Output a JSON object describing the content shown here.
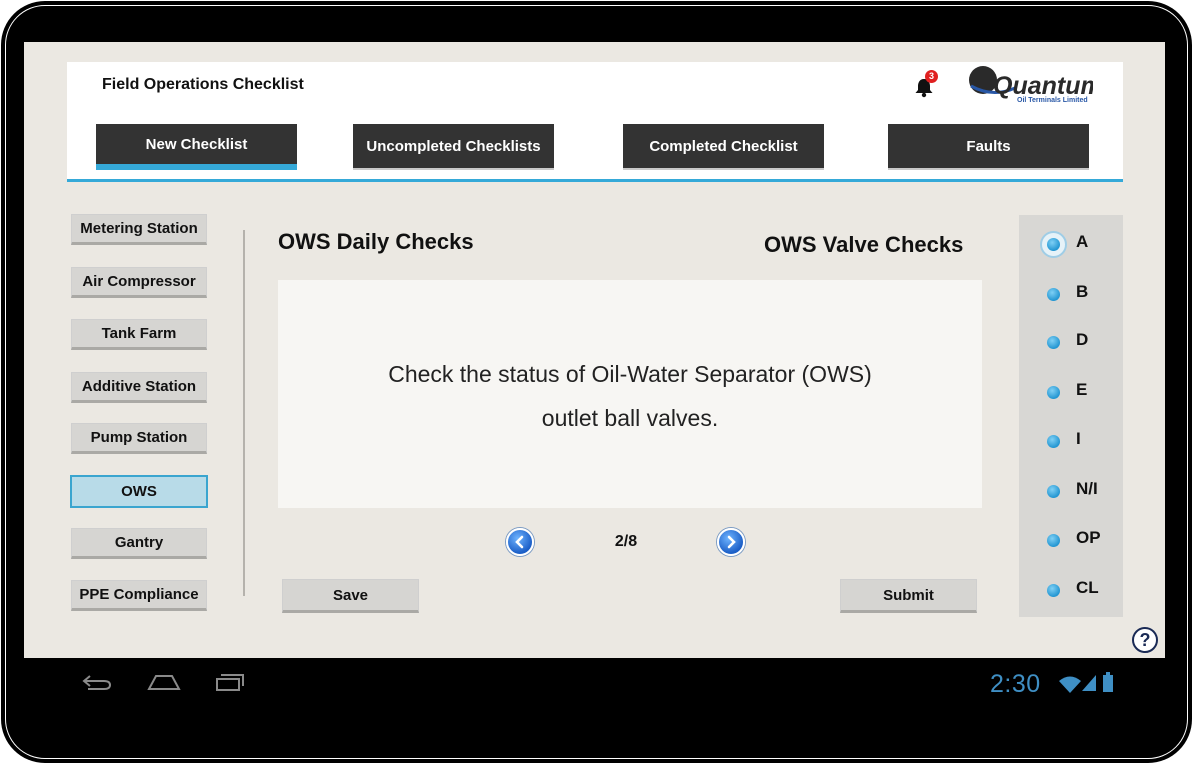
{
  "header": {
    "app_title": "Field Operations Checklist",
    "notification_count": "3",
    "logo_text": "Quantum",
    "logo_subtitle": "Oil Terminals Limited"
  },
  "nav": {
    "tabs": [
      {
        "label": "New Checklist",
        "active": true
      },
      {
        "label": "Uncompleted Checklists",
        "active": false
      },
      {
        "label": "Completed Checklist",
        "active": false
      },
      {
        "label": "Faults",
        "active": false
      }
    ]
  },
  "sidebar": {
    "items": [
      {
        "label": "Metering Station"
      },
      {
        "label": "Air Compressor"
      },
      {
        "label": "Tank Farm"
      },
      {
        "label": "Additive Station"
      },
      {
        "label": "Pump Station"
      },
      {
        "label": "OWS",
        "active": true
      },
      {
        "label": "Gantry"
      },
      {
        "label": "PPE Compliance"
      }
    ]
  },
  "main": {
    "section_title": "OWS Daily Checks",
    "subsection_title": "OWS Valve Checks",
    "question_line1": "Check the status of Oil-Water Separator (OWS)",
    "question_line2": "outlet ball valves.",
    "pager": {
      "current": 2,
      "total": 8,
      "label": "2/8"
    },
    "save_label": "Save",
    "submit_label": "Submit"
  },
  "options": {
    "items": [
      {
        "label": "A",
        "selected": true
      },
      {
        "label": "B",
        "selected": false
      },
      {
        "label": "D",
        "selected": false
      },
      {
        "label": "E",
        "selected": false
      },
      {
        "label": "I",
        "selected": false
      },
      {
        "label": "N/I",
        "selected": false
      },
      {
        "label": "OP",
        "selected": false
      },
      {
        "label": "CL",
        "selected": false
      }
    ]
  },
  "help": {
    "icon": "?"
  },
  "system_bar": {
    "time": "2:30",
    "icons": [
      "back-icon",
      "home-icon",
      "recent-apps-icon",
      "wifi-icon",
      "signal-icon",
      "battery-icon"
    ]
  },
  "colors": {
    "accent": "#35a9d8",
    "tab_bg": "#333333",
    "screen_bg": "#ebe8e2"
  }
}
